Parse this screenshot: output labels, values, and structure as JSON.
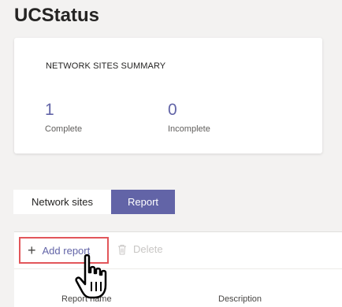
{
  "app": {
    "title": "UCStatus"
  },
  "summary": {
    "title": "NETWORK SITES SUMMARY",
    "stats": [
      {
        "value": "1",
        "label": "Complete"
      },
      {
        "value": "0",
        "label": "Incomplete"
      }
    ]
  },
  "tabs": [
    {
      "label": "Network sites",
      "active": false
    },
    {
      "label": "Report",
      "active": true
    }
  ],
  "toolbar": {
    "add_label": "Add report",
    "delete_label": "Delete"
  },
  "table": {
    "columns": [
      "Report name",
      "Description"
    ]
  },
  "colors": {
    "accent": "#6264a7",
    "highlight_border": "#e2565a",
    "background": "#f3f2f1"
  },
  "icons": [
    "plus-icon",
    "trash-icon",
    "hand-pointer-cursor-icon"
  ]
}
